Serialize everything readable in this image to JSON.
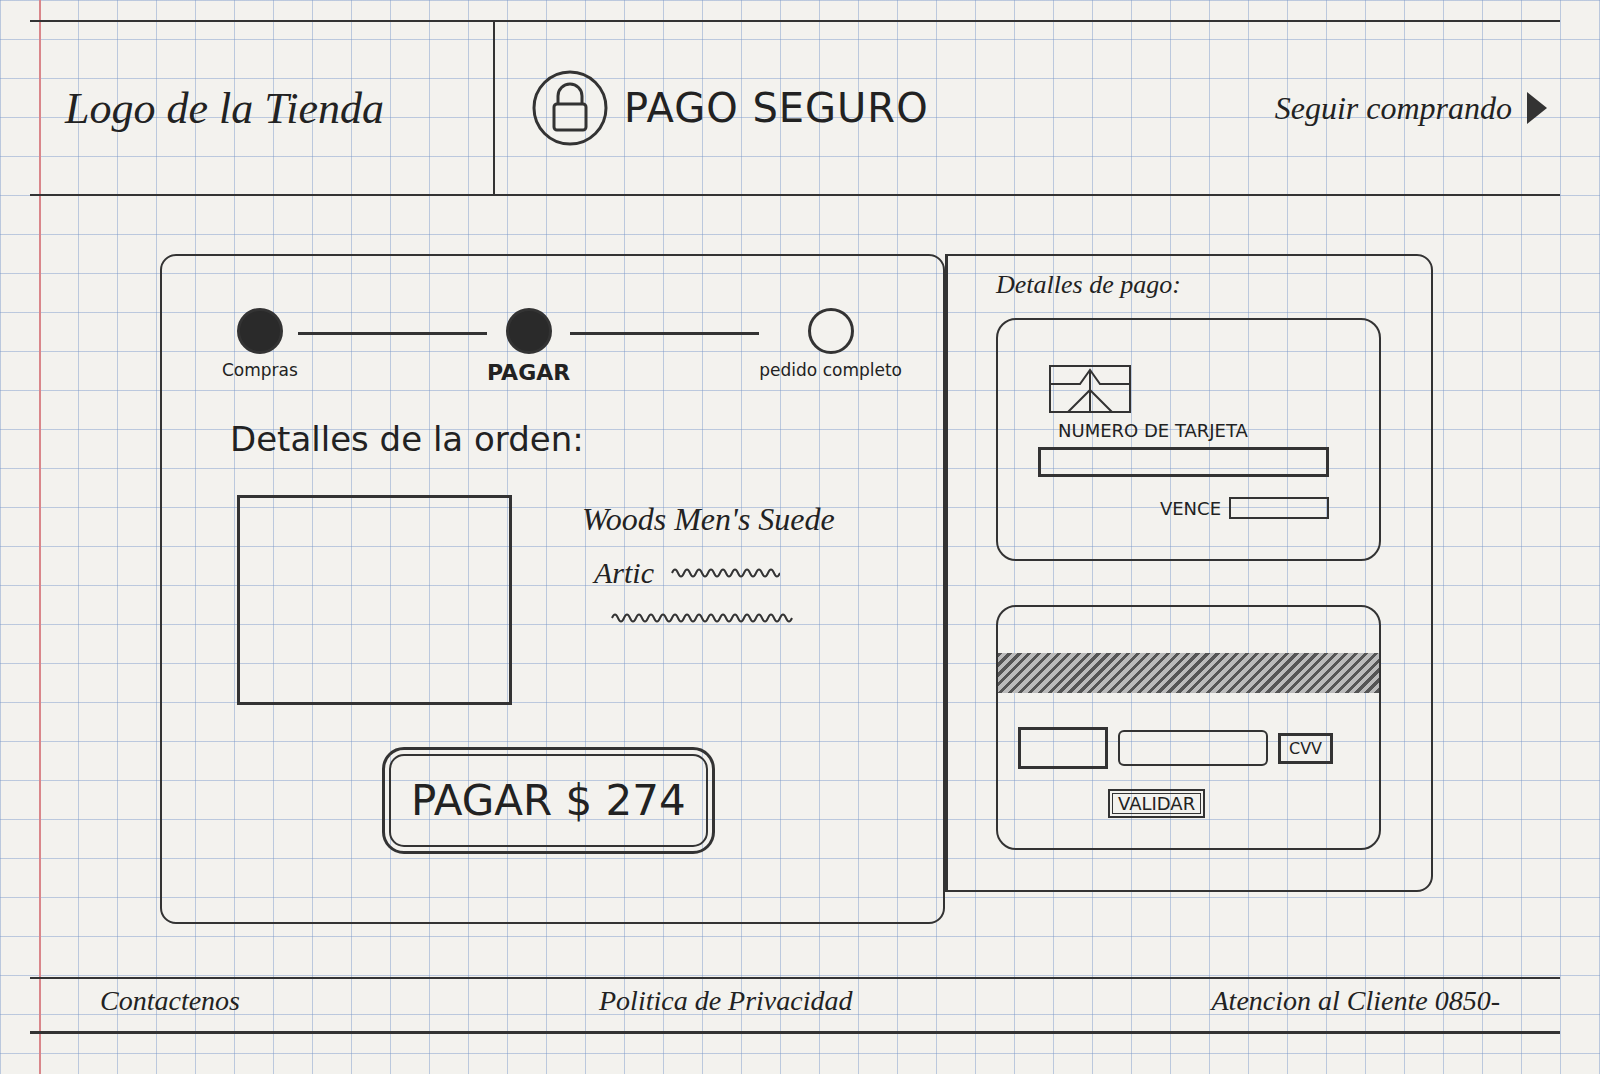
{
  "header": {
    "logo": "Logo de la Tienda",
    "secure_label": "PAGO SEGURO",
    "continue_link": "Seguir comprando"
  },
  "steps": [
    {
      "label": "Compras",
      "filled": true,
      "selected": false
    },
    {
      "label": "PAGAR",
      "filled": true,
      "selected": true
    },
    {
      "label": "pedido completo",
      "filled": false,
      "selected": false
    }
  ],
  "order": {
    "title": "Detalles de la orden:",
    "product_name": "Woods Men's Suede",
    "product_detail": "Artic"
  },
  "pay_button": "PAGAR $ 274",
  "payment": {
    "title": "Detalles de pago:",
    "card_number_label": "NUMERO DE TARJETA",
    "expiry_label": "VENCE",
    "cvv_label": "CVV",
    "validate_button": "VALIDAR"
  },
  "footer": [
    "Contactenos",
    "Politica de Privacidad",
    "Atencion al Cliente 0850-"
  ]
}
